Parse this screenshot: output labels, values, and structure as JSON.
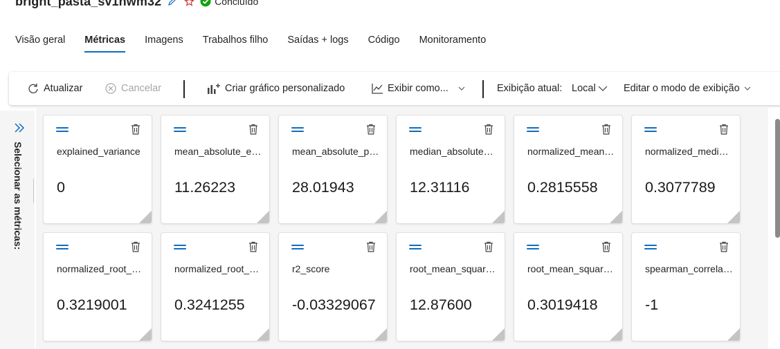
{
  "header": {
    "run_name": "bright_pasta_sv1hwm32",
    "status": "Concluído",
    "colors": {
      "accent": "#0f6cbd",
      "status_ok": "#13a10e",
      "star": "#d13438"
    }
  },
  "tabs": [
    {
      "label": "Visão geral",
      "active": false
    },
    {
      "label": "Métricas",
      "active": true
    },
    {
      "label": "Imagens",
      "active": false
    },
    {
      "label": "Trabalhos filho",
      "active": false
    },
    {
      "label": "Saídas + logs",
      "active": false
    },
    {
      "label": "Código",
      "active": false
    },
    {
      "label": "Monitoramento",
      "active": false
    }
  ],
  "toolbar": {
    "refresh": "Atualizar",
    "cancel": "Cancelar",
    "custom_chart": "Criar gráfico personalizado",
    "view_as": "Exibir como...",
    "current_view_label": "Exibição atual:",
    "current_view_value": "Local",
    "edit_view_mode": "Editar o modo de exibição"
  },
  "side_panel": {
    "label": "Selecionar as métricas:",
    "icon": "double-chevron-right-icon"
  },
  "metrics": [
    {
      "name": "explained_variance",
      "value": "0"
    },
    {
      "name": "mean_absolute_error",
      "value": "11.26223"
    },
    {
      "name": "mean_absolute_percentage_error",
      "value": "28.01943"
    },
    {
      "name": "median_absolute_error",
      "value": "12.31116"
    },
    {
      "name": "normalized_mean_absolute_error",
      "value": "0.2815558"
    },
    {
      "name": "normalized_median_absolute_error",
      "value": "0.3077789"
    },
    {
      "name": "normalized_root_mean_squared_error",
      "value": "0.3219001"
    },
    {
      "name": "normalized_root_mean_squared_log_error",
      "value": "0.3241255"
    },
    {
      "name": "r2_score",
      "value": "-0.03329067"
    },
    {
      "name": "root_mean_squared_error",
      "value": "12.87600"
    },
    {
      "name": "root_mean_squared_log_error",
      "value": "0.3019418"
    },
    {
      "name": "spearman_correlation",
      "value": "-1"
    }
  ]
}
